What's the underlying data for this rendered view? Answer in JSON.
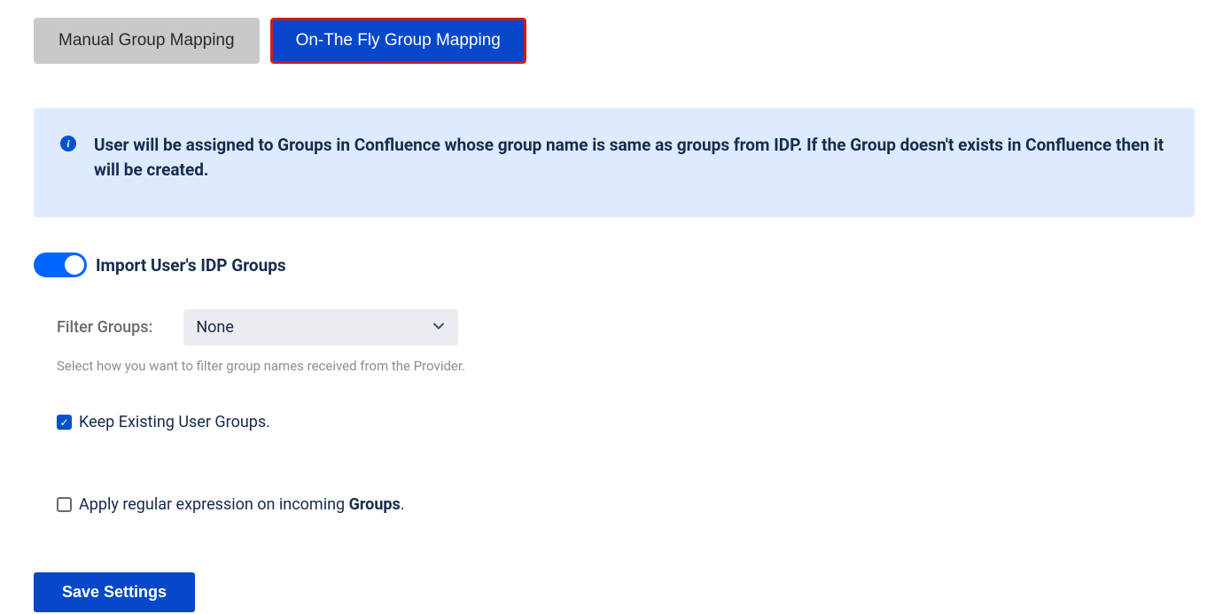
{
  "tabs": {
    "manual": "Manual Group Mapping",
    "onthefly": "On-The Fly Group Mapping"
  },
  "info": {
    "text": "User will be assigned to Groups in Confluence whose group name is same as groups from IDP. If the Group doesn't exists in Confluence then it will be created."
  },
  "toggle": {
    "label": "Import User's IDP Groups"
  },
  "filter": {
    "label": "Filter Groups:",
    "value": "None",
    "help": "Select how you want to filter group names received from the Provider."
  },
  "keepGroups": {
    "label": "Keep Existing User Groups."
  },
  "regex": {
    "label_pre": "Apply regular expression on incoming ",
    "label_bold": "Groups",
    "label_post": "."
  },
  "save": {
    "label": "Save Settings"
  }
}
